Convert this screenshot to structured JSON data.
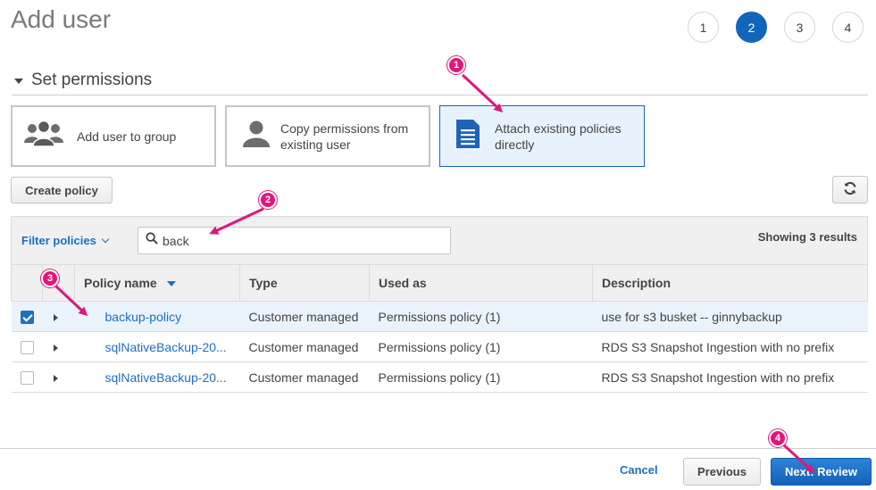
{
  "page": {
    "title": "Add user"
  },
  "steps": [
    "1",
    "2",
    "3",
    "4"
  ],
  "permissions": {
    "section_title": "Set permissions",
    "options": {
      "group": "Add user to group",
      "copy_line1": "Copy permissions from",
      "copy_line2": "existing user",
      "attach_line1": "Attach existing policies",
      "attach_line2": "directly"
    }
  },
  "toolbar": {
    "create_label": "Create policy"
  },
  "filter": {
    "label": "Filter policies",
    "search_value": "back",
    "results": "Showing 3 results"
  },
  "table": {
    "columns": {
      "name": "Policy name",
      "type": "Type",
      "used_as": "Used as",
      "description": "Description"
    },
    "rows": [
      {
        "name": "backup-policy",
        "type": "Customer managed",
        "used_as": "Permissions policy (1)",
        "description": "use for s3 busket -- ginnybackup",
        "checked": true
      },
      {
        "name": "sqlNativeBackup-20...",
        "type": "Customer managed",
        "used_as": "Permissions policy (1)",
        "description": "RDS S3 Snapshot Ingestion with no prefix",
        "checked": false
      },
      {
        "name": "sqlNativeBackup-20...",
        "type": "Customer managed",
        "used_as": "Permissions policy (1)",
        "description": "RDS S3 Snapshot Ingestion with no prefix",
        "checked": false
      }
    ]
  },
  "footer": {
    "cancel": "Cancel",
    "previous": "Previous",
    "next": "Next: Review"
  },
  "annotations": [
    "1",
    "2",
    "3",
    "4"
  ],
  "colors": {
    "accent": "#1166bb",
    "annotation": "#e0177a",
    "selected_bg": "#e8f2fc"
  },
  "icons": [
    "group-icon",
    "user-icon",
    "document-icon",
    "search-icon",
    "refresh-icon",
    "caret-down-icon",
    "expand-caret-icon",
    "sort-caret-icon",
    "chevron-down-icon"
  ]
}
